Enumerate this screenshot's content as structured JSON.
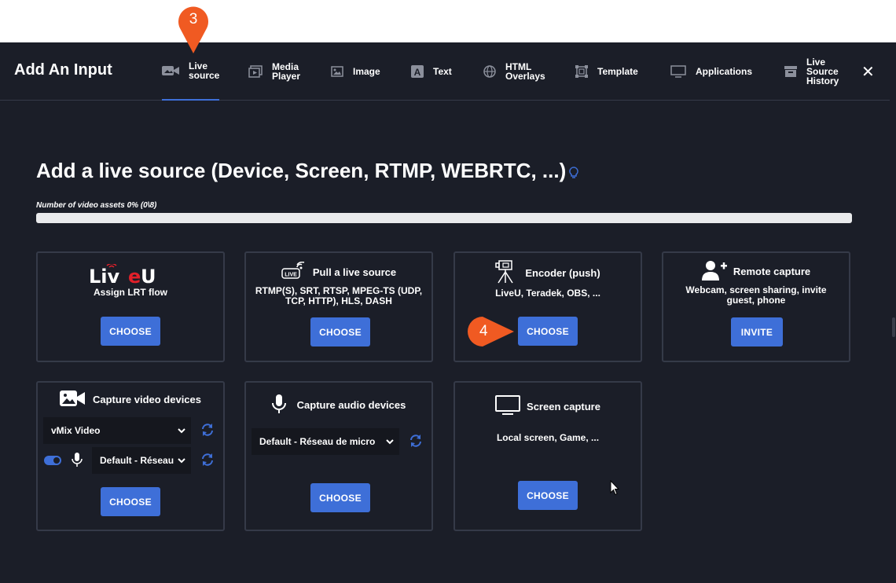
{
  "modal": {
    "title": "Add An Input",
    "close": "✕",
    "tabs": [
      {
        "label_1": "Live",
        "label_2": "source",
        "icon": "camera-icon"
      },
      {
        "label_1": "Media",
        "label_2": "Player",
        "icon": "media-player-icon"
      },
      {
        "label_1": "Image",
        "icon": "image-icon"
      },
      {
        "label_1": "Text",
        "icon": "text-icon"
      },
      {
        "label_1": "HTML",
        "label_2": "Overlays",
        "icon": "globe-icon"
      },
      {
        "label_1": "Template",
        "icon": "template-icon"
      },
      {
        "label_1": "Applications",
        "icon": "monitor-icon"
      },
      {
        "label_1": "Live",
        "label_2": "Source",
        "label_3": "History",
        "icon": "archive-icon"
      }
    ]
  },
  "page": {
    "heading": "Add a live source (Device, Screen, RTMP, WEBRTC, ...)",
    "assets_label": "Number of video assets 0% (0\\8)",
    "assets_progress": 0
  },
  "cards": {
    "liveu": {
      "logo_text": "LiveU",
      "title": "Assign LRT flow",
      "button": "CHOOSE"
    },
    "pull": {
      "title": "Pull a live source",
      "desc_1": "RTMP(S), SRT, RTSP, MPEG-TS (UDP,",
      "desc_2": "TCP, HTTP), HLS, DASH",
      "button": "CHOOSE"
    },
    "encoder": {
      "title": "Encoder (push)",
      "desc": "LiveU, Teradek, OBS, ...",
      "button": "CHOOSE"
    },
    "remote": {
      "title": "Remote capture",
      "desc_1": "Webcam, screen sharing, invite",
      "desc_2": "guest, phone",
      "button": "INVITE"
    },
    "video": {
      "title": "Capture video devices",
      "video_select": "vMix Video",
      "audio_select": "Default - Réseau",
      "button": "CHOOSE"
    },
    "audio": {
      "title": "Capture audio devices",
      "audio_select": "Default - Réseau de micro",
      "button": "CHOOSE"
    },
    "screen": {
      "title": "Screen capture",
      "desc": "Local screen, Game, ...",
      "button": "CHOOSE"
    }
  },
  "callouts": {
    "step_3": "3",
    "step_4": "4"
  },
  "colors": {
    "background": "#1b1e28",
    "accent": "#3e6fd8",
    "callout": "#f05a22",
    "card_border": "#353a48"
  }
}
